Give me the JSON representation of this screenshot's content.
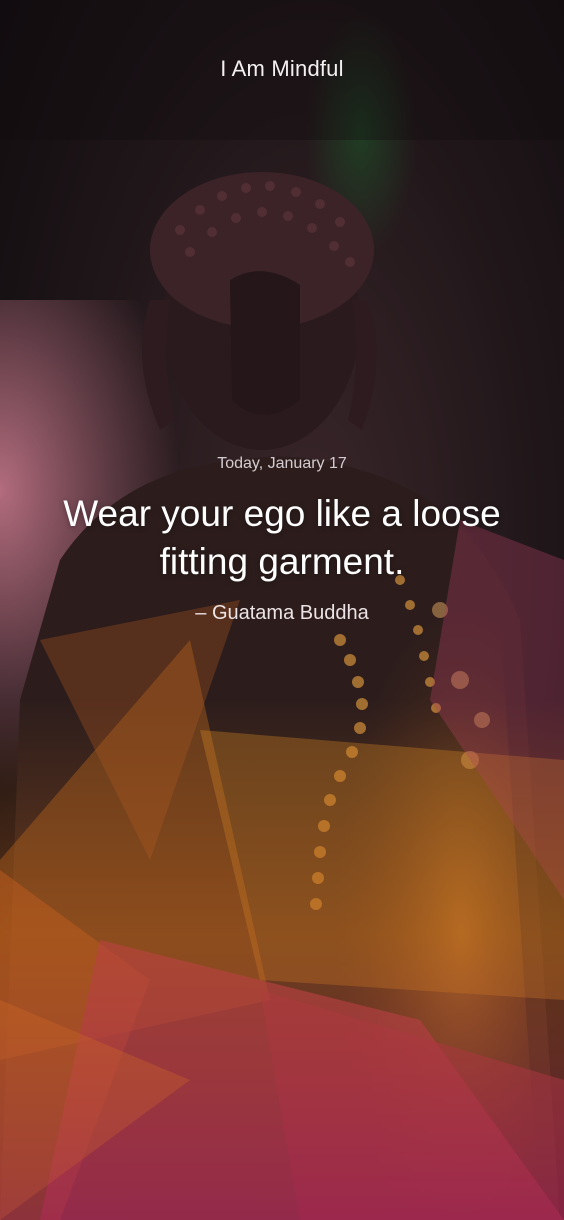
{
  "app": {
    "title": "I Am Mindful"
  },
  "quote_card": {
    "date": "Today, January 17",
    "text": "Wear your ego like a loose fitting garment.",
    "author": "– Guatama Buddha"
  },
  "background": {
    "subject": "buddha-statue-photo",
    "colors": {
      "dark": "#140f12",
      "orange": "#e07a1c",
      "magenta": "#b3285a",
      "gold": "#d8a02a"
    }
  }
}
